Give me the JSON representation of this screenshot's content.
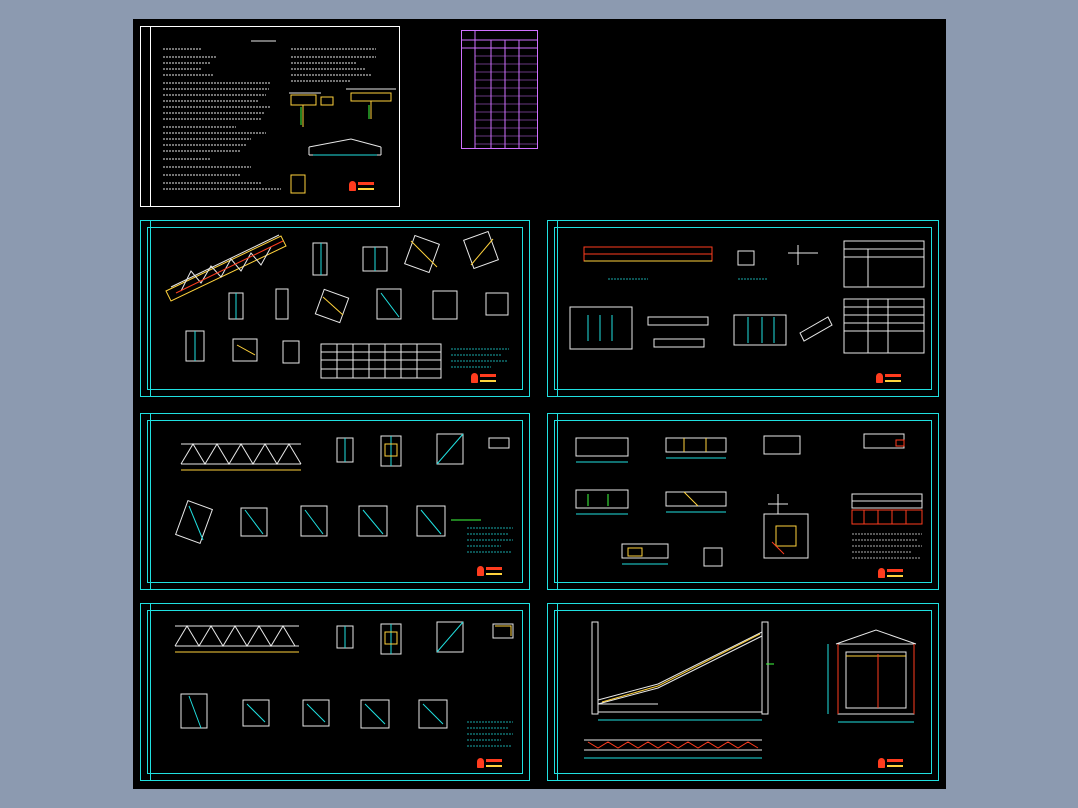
{
  "viewer": {
    "background_color": "#8c9ab0",
    "drawing_area_color": "#000000"
  },
  "sheets": [
    {
      "id": "sheet-1",
      "name": "design-notes-sheet",
      "border_color": "#ffffff"
    },
    {
      "id": "sheet-2",
      "name": "truss-joint-details-sheet",
      "border_color": "#20e0e0"
    },
    {
      "id": "sheet-3",
      "name": "member-schedule-sheet",
      "border_color": "#20e0e0"
    },
    {
      "id": "sheet-4",
      "name": "truss-elevation-a-sheet",
      "border_color": "#20e0e0"
    },
    {
      "id": "sheet-5",
      "name": "column-base-details-sheet",
      "border_color": "#20e0e0"
    },
    {
      "id": "sheet-6",
      "name": "truss-elevation-b-sheet",
      "border_color": "#20e0e0"
    },
    {
      "id": "sheet-7",
      "name": "gallery-section-sheet",
      "border_color": "#20e0e0"
    }
  ],
  "colors": {
    "line_white": "#e8e8e8",
    "line_cyan": "#20e0e0",
    "line_yellow": "#ffd23c",
    "line_red": "#ff3c1e",
    "line_magenta": "#d070ff",
    "line_green": "#40ff40"
  }
}
